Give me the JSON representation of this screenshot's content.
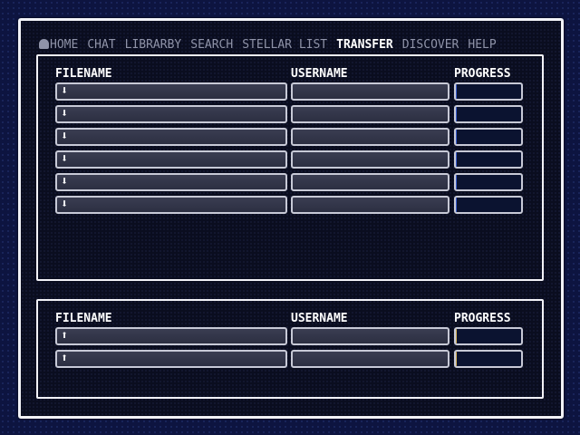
{
  "menu": {
    "items": [
      {
        "label": "HOME",
        "icon": "home-icon"
      },
      {
        "label": "CHAT"
      },
      {
        "label": "LIBRARBY"
      },
      {
        "label": "SEARCH"
      },
      {
        "label": "STELLAR LIST"
      },
      {
        "label": "TRANSFER",
        "active": true
      },
      {
        "label": "DISCOVER"
      },
      {
        "label": "HELP"
      }
    ]
  },
  "downloads": {
    "headers": {
      "filename": "FILENAME",
      "username": "USERNAME",
      "progress": "PROGRESS"
    },
    "direction_icon": "arrow-down-icon",
    "rows": [
      {
        "filename": "",
        "username": "",
        "progress": 0.02
      },
      {
        "filename": "",
        "username": "",
        "progress": 0.02
      },
      {
        "filename": "",
        "username": "",
        "progress": 0.02
      },
      {
        "filename": "",
        "username": "",
        "progress": 0.02
      },
      {
        "filename": "",
        "username": "",
        "progress": 0.02
      },
      {
        "filename": "",
        "username": "",
        "progress": 0.02
      }
    ]
  },
  "uploads": {
    "headers": {
      "filename": "FILENAME",
      "username": "USERNAME",
      "progress": "PROGRESS"
    },
    "direction_icon": "arrow-up-icon",
    "rows": [
      {
        "filename": "",
        "username": "",
        "progress": 0.02
      },
      {
        "filename": "",
        "username": "",
        "progress": 0.02
      }
    ]
  },
  "colors": {
    "background": "#0d1440",
    "border": "#f2f2f7",
    "active_menu": "#ffffff",
    "inactive_menu": "#8f93a8",
    "download_progress": "#3a5dd0",
    "upload_progress": "#d7b35a"
  }
}
